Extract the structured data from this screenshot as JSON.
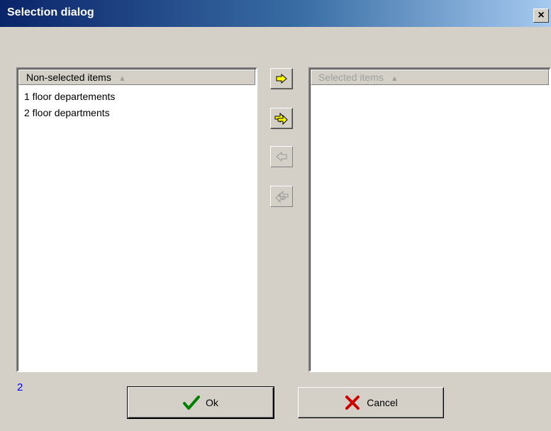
{
  "window": {
    "title": "Selection dialog",
    "close_label": "×"
  },
  "left_list": {
    "header": "Non-selected items",
    "sort_glyph": "▲",
    "items": [
      "1 floor departements",
      "2 floor departments"
    ]
  },
  "right_list": {
    "header": "Selected items",
    "sort_glyph": "▲",
    "items": []
  },
  "transfer_buttons": [
    {
      "icon": "arrow-right-icon",
      "enabled": true
    },
    {
      "icon": "double-arrow-right-icon",
      "enabled": true
    },
    {
      "icon": "arrow-left-icon",
      "enabled": false
    },
    {
      "icon": "double-arrow-left-icon",
      "enabled": false
    }
  ],
  "count": "2",
  "buttons": {
    "ok_label": "Ok",
    "ok_icon": "checkmark-icon",
    "cancel_label": "Cancel",
    "cancel_icon": "x-icon"
  },
  "colors": {
    "title_start": "#0a246a",
    "title_end": "#a6caf0",
    "arrow_fill": "#ffff00",
    "check": "#008000",
    "cancel_x": "#cc0000",
    "count": "#0000ff"
  }
}
